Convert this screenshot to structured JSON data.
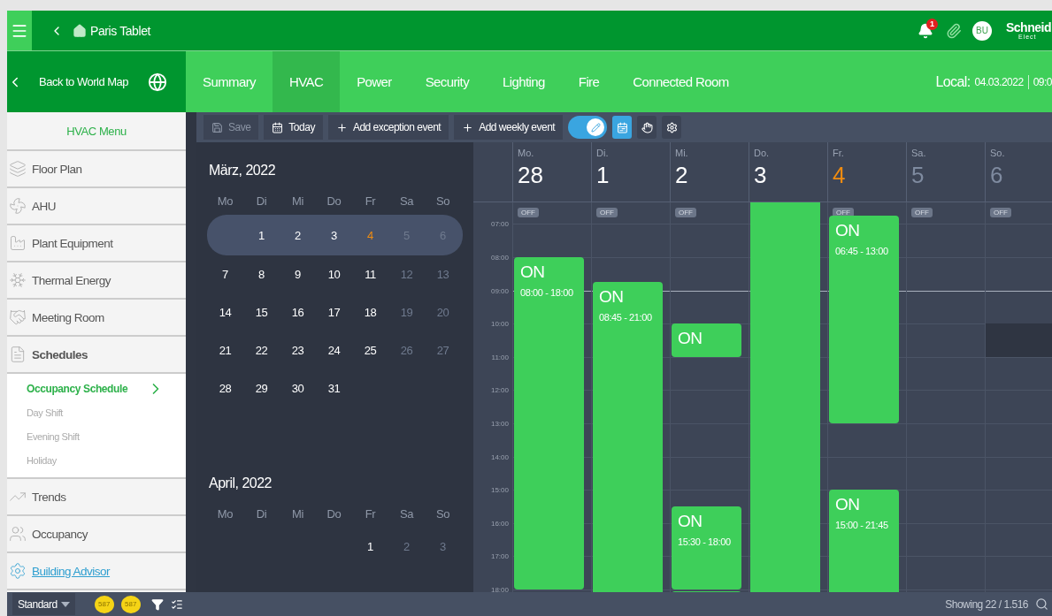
{
  "top_bar": {
    "title": "Paris Tablet",
    "notification_count": "1",
    "avatar": "BU",
    "logo": {
      "name": "Schneid",
      "sub": "Elect"
    }
  },
  "nav_bar": {
    "back_label": "Back to World Map",
    "tabs": [
      {
        "label": "Summary",
        "selected": false
      },
      {
        "label": "HVAC",
        "selected": true
      },
      {
        "label": "Power",
        "selected": false
      },
      {
        "label": "Security",
        "selected": false
      },
      {
        "label": "Lighting",
        "selected": false
      },
      {
        "label": "Fire",
        "selected": false
      },
      {
        "label": "Connected Room",
        "selected": false
      }
    ],
    "local_label": "Local:",
    "local_date": "04.03.2022",
    "local_time": "09:0"
  },
  "sidebar": {
    "title": "HVAC Menu",
    "items": [
      {
        "label": "Floor Plan",
        "kind": "item",
        "expanded": false
      },
      {
        "label": "AHU",
        "kind": "item",
        "expanded": false
      },
      {
        "label": "Plant Equipment",
        "kind": "item",
        "expanded": false
      },
      {
        "label": "Thermal Energy",
        "kind": "item",
        "expanded": false
      },
      {
        "label": "Meeting Room",
        "kind": "item",
        "expanded": false
      },
      {
        "label": "Schedules",
        "kind": "item",
        "expanded": true,
        "children": [
          {
            "label": "Occupancy Schedule",
            "selected": true
          },
          {
            "label": "Day Shift",
            "selected": false
          },
          {
            "label": "Evening Shift",
            "selected": false
          },
          {
            "label": "Holiday",
            "selected": false
          }
        ]
      },
      {
        "label": "Trends",
        "kind": "item",
        "expanded": false
      },
      {
        "label": "Occupancy",
        "kind": "item",
        "expanded": false
      },
      {
        "label": "Building Advisor",
        "kind": "link",
        "expanded": false
      }
    ]
  },
  "toolbar": {
    "buttons": [
      {
        "label": "Save",
        "kind": "save",
        "disabled": true
      },
      {
        "label": "Today",
        "kind": "today",
        "disabled": false
      },
      {
        "label": "Add exception event",
        "kind": "add",
        "disabled": false
      },
      {
        "label": "Add weekly event",
        "kind": "add",
        "disabled": false
      }
    ],
    "edit_toggle": {
      "on": true
    },
    "view_buttons": [
      {
        "kind": "calendar",
        "selected": true
      },
      {
        "kind": "hand",
        "selected": false
      },
      {
        "kind": "gear",
        "selected": false
      }
    ]
  },
  "mini_calendar": [
    {
      "title": "März, 2022",
      "weekdays": [
        "Mo",
        "Di",
        "Mi",
        "Do",
        "Fr",
        "Sa",
        "So"
      ],
      "weeks": [
        {
          "selected": true,
          "right_aligned": true,
          "days": [
            {
              "n": "1",
              "today": false
            },
            {
              "n": "2",
              "today": false
            },
            {
              "n": "3",
              "today": false
            },
            {
              "n": "4",
              "today": true
            },
            {
              "n": "5",
              "today": false
            },
            {
              "n": "6",
              "today": false
            }
          ]
        },
        {
          "selected": false,
          "days": [
            {
              "n": "7",
              "today": false
            },
            {
              "n": "8",
              "today": false
            },
            {
              "n": "9",
              "today": false
            },
            {
              "n": "10",
              "today": false
            },
            {
              "n": "11",
              "today": false
            },
            {
              "n": "12",
              "today": false
            },
            {
              "n": "13",
              "today": false
            }
          ]
        },
        {
          "selected": false,
          "days": [
            {
              "n": "14",
              "today": false
            },
            {
              "n": "15",
              "today": false
            },
            {
              "n": "16",
              "today": false
            },
            {
              "n": "17",
              "today": false
            },
            {
              "n": "18",
              "today": false
            },
            {
              "n": "19",
              "today": false
            },
            {
              "n": "20",
              "today": false
            }
          ]
        },
        {
          "selected": false,
          "days": [
            {
              "n": "21",
              "today": false
            },
            {
              "n": "22",
              "today": false
            },
            {
              "n": "23",
              "today": false
            },
            {
              "n": "24",
              "today": false
            },
            {
              "n": "25",
              "today": false
            },
            {
              "n": "26",
              "today": false
            },
            {
              "n": "27",
              "today": false
            }
          ]
        },
        {
          "selected": false,
          "right_aligned": false,
          "days": [
            {
              "n": "28",
              "today": false
            },
            {
              "n": "29",
              "today": false
            },
            {
              "n": "30",
              "today": false
            },
            {
              "n": "31",
              "today": false
            }
          ]
        }
      ]
    },
    {
      "title": "April, 2022",
      "weekdays": [
        "Mo",
        "Di",
        "Mi",
        "Do",
        "Fr",
        "Sa",
        "So"
      ],
      "weeks": [
        {
          "selected": false,
          "right_aligned": true,
          "days": [
            {
              "n": "1",
              "today": false
            },
            {
              "n": "2",
              "today": false
            },
            {
              "n": "3",
              "today": false
            }
          ]
        }
      ]
    }
  ],
  "week_view": {
    "hours": [
      {
        "label": "07:00",
        "current": false
      },
      {
        "label": "08:00",
        "current": false
      },
      {
        "label": "09:00",
        "current": true
      },
      {
        "label": "10:00",
        "current": false
      },
      {
        "label": "11:00",
        "current": false
      },
      {
        "label": "12:00",
        "current": false
      },
      {
        "label": "13:00",
        "current": false
      },
      {
        "label": "14:00",
        "current": false
      },
      {
        "label": "15:00",
        "current": false
      },
      {
        "label": "16:00",
        "current": false
      },
      {
        "label": "17:00",
        "current": false
      },
      {
        "label": "18:00",
        "current": false
      }
    ],
    "days": [
      {
        "weekday": "Mo.",
        "date": "28",
        "today": false,
        "weekend": false,
        "off_label": "OFF",
        "events": [
          {
            "kind": "on",
            "label": "ON",
            "time": "08:00 - 18:00"
          }
        ]
      },
      {
        "weekday": "Di.",
        "date": "1",
        "today": false,
        "weekend": false,
        "off_label": "OFF",
        "events": [
          {
            "kind": "on",
            "label": "ON",
            "time": "08:45 - 21:00"
          }
        ]
      },
      {
        "weekday": "Mi.",
        "date": "2",
        "today": false,
        "weekend": false,
        "off_label": "OFF",
        "events": [
          {
            "kind": "on",
            "label": "ON"
          },
          {
            "kind": "on",
            "label": "ON",
            "time": "15:30 - 18:00"
          },
          {
            "kind": "on"
          }
        ]
      },
      {
        "weekday": "Do.",
        "date": "3",
        "today": false,
        "weekend": false,
        "events": [
          {
            "kind": "on"
          }
        ]
      },
      {
        "weekday": "Fr.",
        "date": "4",
        "today": true,
        "weekend": false,
        "off_label": "OFF",
        "events": [
          {
            "kind": "on",
            "label": "ON",
            "time": "06:45 - 13:00"
          },
          {
            "kind": "on",
            "label": "ON",
            "time": "15:00 - 21:45"
          }
        ]
      },
      {
        "weekday": "Sa.",
        "date": "5",
        "today": false,
        "weekend": true,
        "off_label": "OFF"
      },
      {
        "weekday": "So.",
        "date": "6",
        "today": false,
        "weekend": true,
        "off_label": "OFF",
        "events": [
          {
            "kind": "selection"
          }
        ]
      }
    ]
  },
  "bottom_bar": {
    "view_select": "Standard",
    "badges": [
      "587",
      "587"
    ],
    "status": "Showing 22 / 1.516"
  }
}
